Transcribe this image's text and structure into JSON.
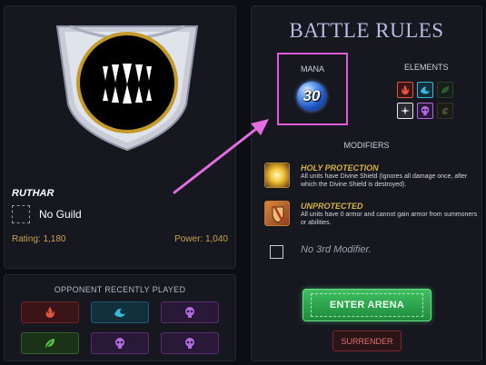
{
  "player": {
    "name": "RUTHAR",
    "guild": "No Guild",
    "rating_label": "Rating: 1,180",
    "power_label": "Power: 1,040"
  },
  "opponent": {
    "title": "OPPONENT RECENTLY PLAYED",
    "recent": [
      {
        "icon": "fire-icon",
        "color": "#e0533c"
      },
      {
        "icon": "water-icon",
        "color": "#3ab7d8"
      },
      {
        "icon": "death-icon",
        "color": "#b16be0"
      },
      {
        "icon": "earth-icon",
        "color": "#5cc04a"
      },
      {
        "icon": "death-icon",
        "color": "#b16be0"
      },
      {
        "icon": "death-icon",
        "color": "#b16be0"
      }
    ]
  },
  "rules": {
    "title": "BATTLE RULES",
    "mana_label": "MANA",
    "mana_value": "30",
    "elements_label": "ELEMENTS",
    "elements": [
      {
        "icon": "fire-icon",
        "active": true
      },
      {
        "icon": "water-icon",
        "active": true
      },
      {
        "icon": "earth-icon",
        "active": false
      },
      {
        "icon": "life-icon",
        "active": true
      },
      {
        "icon": "death-icon",
        "active": true
      },
      {
        "icon": "dragon-icon",
        "active": false
      }
    ],
    "modifiers_label": "MODIFIERS",
    "modifiers": [
      {
        "title": "HOLY PROTECTION",
        "description": "All units have Divine Shield (Ignores all damage once, after which the Divine Shield is destroyed)."
      },
      {
        "title": "UNPROTECTED",
        "description": "All units have 0 armor and cannot gain armor from summoners or abilities."
      }
    ],
    "third_modifier": "No 3rd Modifier."
  },
  "actions": {
    "enter_label": "ENTER ARENA",
    "surrender_label": "SURRENDER"
  },
  "colors": {
    "highlight": "#e05ad8",
    "gold": "#d6b341",
    "enter_green": "#2fa64e"
  }
}
